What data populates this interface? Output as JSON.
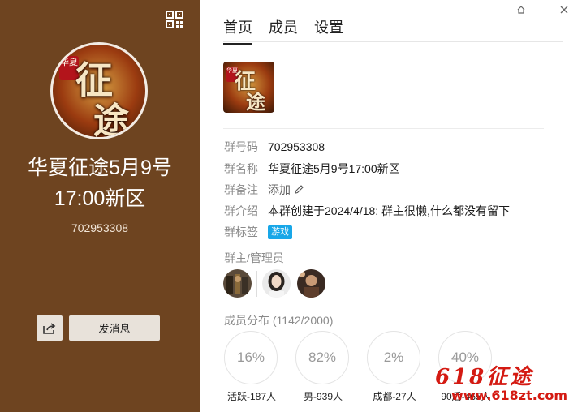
{
  "group": {
    "name_line1": "华夏征途5月9号",
    "name_line2": "17:00新区",
    "id": "702953308",
    "avatar_text_tag": "华夏",
    "avatar_text_main1": "征",
    "avatar_text_main2": "途"
  },
  "left_actions": {
    "send_message": "发消息",
    "share_icon": "share-icon",
    "qr_icon": "qr-code-icon"
  },
  "tabs": [
    {
      "label": "首页",
      "active": true
    },
    {
      "label": "成员",
      "active": false
    },
    {
      "label": "设置",
      "active": false
    }
  ],
  "info": {
    "id_label": "群号码",
    "id_value": "702953308",
    "name_label": "群名称",
    "name_value": "华夏征途5月9号17:00新区",
    "remark_label": "群备注",
    "remark_value": "添加",
    "intro_label": "群介绍",
    "intro_value": "本群创建于2024/4/18:  群主很懒,什么都没有留下",
    "tags_label": "群标签",
    "tag_value": "游戏"
  },
  "admins_label": "群主/管理员",
  "distribution": {
    "label": "成员分布",
    "count": "(1142/2000)",
    "stats": [
      {
        "percent": "16%",
        "label": "活跃-187人"
      },
      {
        "percent": "82%",
        "label": "男-939人"
      },
      {
        "percent": "2%",
        "label": "成都-27人"
      },
      {
        "percent": "40%",
        "label": "90后-465人"
      }
    ]
  },
  "watermark": {
    "brand": "618征途",
    "url": "www.618zt.com"
  },
  "colors": {
    "left_panel": "#6e4420",
    "tag_bg": "#18a7e8",
    "watermark": "#d41a12"
  }
}
